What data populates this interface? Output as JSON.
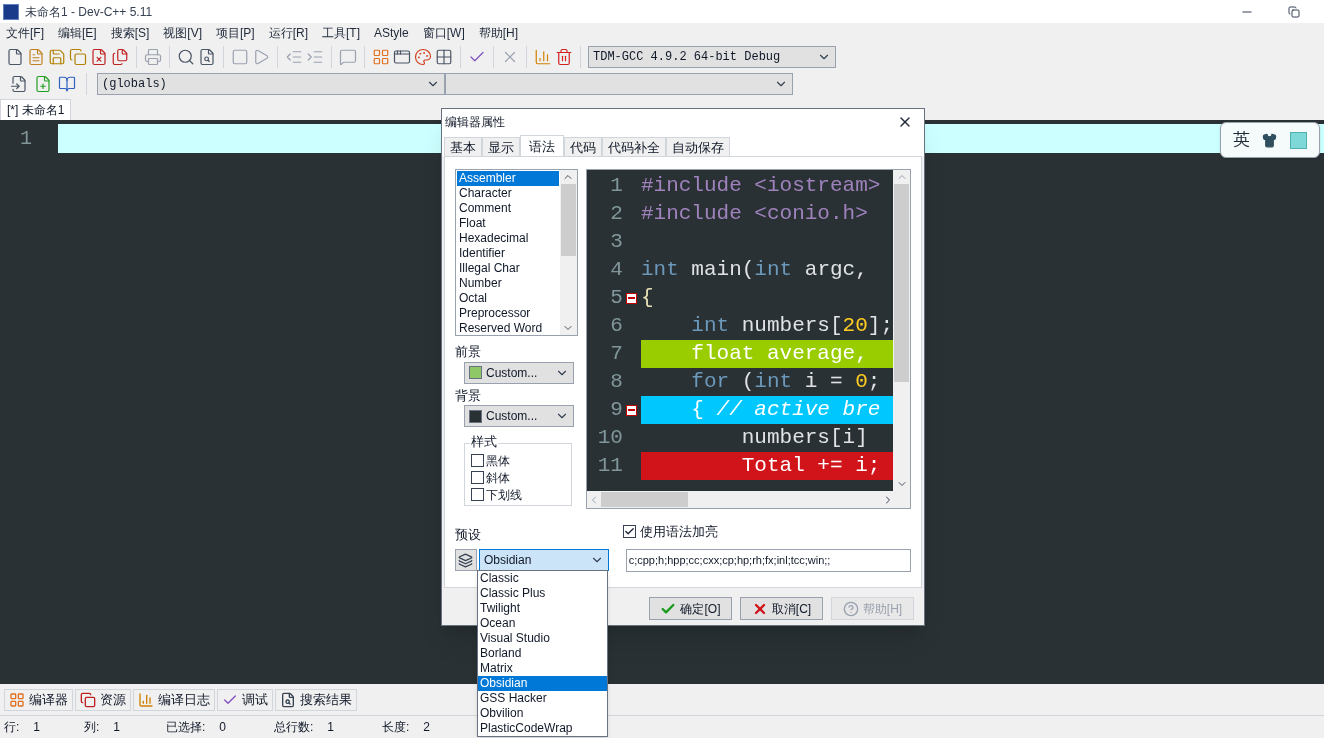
{
  "window": {
    "title": "未命名1 - Dev-C++ 5.11"
  },
  "menu": [
    "文件[F]",
    "编辑[E]",
    "搜索[S]",
    "视图[V]",
    "项目[P]",
    "运行[R]",
    "工具[T]",
    "AStyle",
    "窗口[W]",
    "帮助[H]"
  ],
  "compiler_select": {
    "value": "TDM-GCC 4.9.2 64-bit Debug"
  },
  "scope_select": {
    "value": "(globals)"
  },
  "editor": {
    "tabs": [
      {
        "label": "[*] 未命名1",
        "selected": true
      }
    ],
    "lines": [
      {
        "number": "1",
        "current": true
      }
    ]
  },
  "ime": {
    "label": "英"
  },
  "dialog": {
    "title": "编辑器属性",
    "tabs": [
      {
        "label": "基本",
        "selected": false
      },
      {
        "label": "显示",
        "selected": false
      },
      {
        "label": "语法",
        "selected": true
      },
      {
        "label": "代码",
        "selected": false
      },
      {
        "label": "代码补全",
        "selected": false
      },
      {
        "label": "自动保存",
        "selected": false
      }
    ],
    "elements": [
      {
        "label": "Assembler",
        "selected": true
      },
      {
        "label": "Character",
        "selected": false
      },
      {
        "label": "Comment",
        "selected": false
      },
      {
        "label": "Float",
        "selected": false
      },
      {
        "label": "Hexadecimal",
        "selected": false
      },
      {
        "label": "Identifier",
        "selected": false
      },
      {
        "label": "Illegal Char",
        "selected": false
      },
      {
        "label": "Number",
        "selected": false
      },
      {
        "label": "Octal",
        "selected": false
      },
      {
        "label": "Preprocessor",
        "selected": false
      },
      {
        "label": "Reserved Word",
        "selected": false
      }
    ],
    "foreground": {
      "label": "前景",
      "value": "Custom...",
      "color": "#8fc866"
    },
    "background": {
      "label": "背景",
      "value": "Custom...",
      "color": "#293134"
    },
    "style": {
      "title": "样式",
      "options": [
        {
          "label": "黑体",
          "checked": false
        },
        {
          "label": "斜体",
          "checked": false
        },
        {
          "label": "下划线",
          "checked": false
        }
      ]
    },
    "preview": {
      "lines": [
        {
          "number": "1",
          "kind": "plain",
          "fold": false,
          "tokens": [
            {
              "text": "#include <iostream>",
              "kind": "preprocessor"
            }
          ]
        },
        {
          "number": "2",
          "kind": "plain",
          "fold": false,
          "tokens": [
            {
              "text": "#include <conio.h>",
              "kind": "preprocessor"
            }
          ]
        },
        {
          "number": "3",
          "kind": "plain",
          "fold": false
        },
        {
          "number": "4",
          "kind": "plain",
          "fold": false,
          "tokens": [
            {
              "text": "int",
              "kind": "keyword"
            },
            {
              "text": " main(",
              "kind": "identifier"
            },
            {
              "text": "int",
              "kind": "keyword"
            },
            {
              "text": " argc,",
              "kind": "identifier"
            }
          ]
        },
        {
          "number": "5",
          "kind": "plain",
          "fold": true,
          "tokens": [
            {
              "text": "{",
              "kind": "symbol"
            }
          ]
        },
        {
          "number": "6",
          "kind": "plain",
          "fold": false,
          "tokens": [
            {
              "text": "    int",
              "kind": "keyword"
            },
            {
              "text": " numbers[",
              "kind": "identifier"
            },
            {
              "text": "20",
              "kind": "number"
            },
            {
              "text": "];",
              "kind": "identifier"
            }
          ]
        },
        {
          "number": "7",
          "kind": "selection",
          "fold": false,
          "tokens": [
            {
              "text": "    float average,",
              "kind": "identifier"
            }
          ]
        },
        {
          "number": "8",
          "kind": "plain",
          "fold": false,
          "tokens": [
            {
              "text": "    for",
              "kind": "keyword"
            },
            {
              "text": " (",
              "kind": "identifier"
            },
            {
              "text": "int",
              "kind": "keyword"
            },
            {
              "text": " i = ",
              "kind": "identifier"
            },
            {
              "text": "0",
              "kind": "number"
            },
            {
              "text": ";",
              "kind": "identifier"
            }
          ]
        },
        {
          "number": "9",
          "kind": "breakpoint",
          "fold": true,
          "tokens": [
            {
              "text": "    { ",
              "kind": "identifier"
            },
            {
              "text": "// active bre",
              "kind": "comment"
            }
          ]
        },
        {
          "number": "10",
          "kind": "plain",
          "fold": false,
          "tokens": [
            {
              "text": "        numbers[i]",
              "kind": "identifier"
            }
          ]
        },
        {
          "number": "11",
          "kind": "error",
          "fold": false,
          "tokens": [
            {
              "text": "        Total += i;",
              "kind": "identifier"
            }
          ]
        }
      ]
    },
    "syntax_highlight": {
      "label": "使用语法加亮",
      "checked": true
    },
    "extensions": {
      "value": "c;cpp;h;hpp;cc;cxx;cp;hp;rh;fx;inl;tcc;win;;"
    },
    "preset": {
      "label": "预设",
      "value": "Obsidian",
      "expanded": true,
      "options": [
        {
          "label": "Classic",
          "selected": false
        },
        {
          "label": "Classic Plus",
          "selected": false
        },
        {
          "label": "Twilight",
          "selected": false
        },
        {
          "label": "Ocean",
          "selected": false
        },
        {
          "label": "Visual Studio",
          "selected": false
        },
        {
          "label": "Borland",
          "selected": false
        },
        {
          "label": "Matrix",
          "selected": false
        },
        {
          "label": "Obsidian",
          "selected": true
        },
        {
          "label": "GSS Hacker",
          "selected": false
        },
        {
          "label": "Obvilion",
          "selected": false
        },
        {
          "label": "PlasticCodeWrap",
          "selected": false
        }
      ]
    },
    "buttons": [
      {
        "label": "确定[O]",
        "kind": "ok",
        "disabled": false
      },
      {
        "label": "取消[C]",
        "kind": "cancel",
        "disabled": false
      },
      {
        "label": "帮助[H]",
        "kind": "help",
        "disabled": true
      }
    ]
  },
  "bottom_tabs": [
    {
      "label": "编译器",
      "selected": false
    },
    {
      "label": "资源",
      "selected": false
    },
    {
      "label": "编译日志",
      "selected": false
    },
    {
      "label": "调试",
      "selected": false
    },
    {
      "label": "搜索结果",
      "selected": false
    }
  ],
  "status_bar": [
    {
      "label": "行:",
      "value": "1"
    },
    {
      "label": "列:",
      "value": "1"
    },
    {
      "label": "已选择:",
      "value": "0"
    },
    {
      "label": "总行数:",
      "value": "1"
    },
    {
      "label": "长度:",
      "value": "2"
    }
  ]
}
